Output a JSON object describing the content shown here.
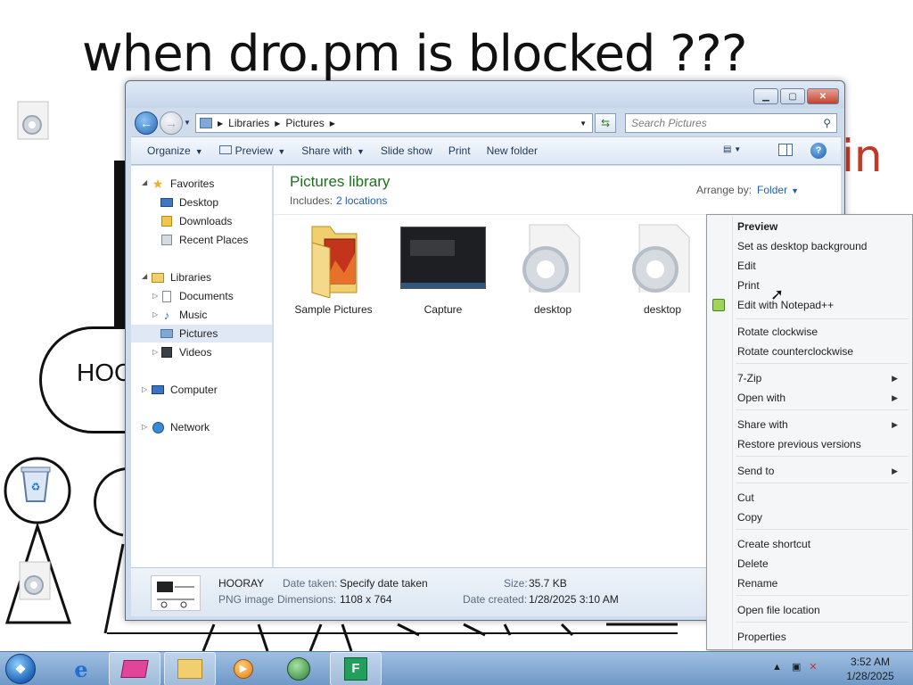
{
  "wallpaper": {
    "title": "when dro.pm is blocked ???",
    "side_text": "in",
    "bubble_text": "HOC"
  },
  "window": {
    "address": {
      "crumbs": [
        "Libraries",
        "Pictures"
      ]
    },
    "search_placeholder": "Search Pictures",
    "toolbar": {
      "organize": "Organize",
      "preview": "Preview",
      "share_with": "Share with",
      "slide_show": "Slide show",
      "print": "Print",
      "new_folder": "New folder"
    },
    "nav": {
      "favorites": "Favorites",
      "desktop": "Desktop",
      "downloads": "Downloads",
      "recent_places": "Recent Places",
      "libraries": "Libraries",
      "documents": "Documents",
      "music": "Music",
      "pictures": "Pictures",
      "videos": "Videos",
      "computer": "Computer",
      "network": "Network"
    },
    "library": {
      "title": "Pictures library",
      "includes_label": "Includes:",
      "locations_link": "2 locations",
      "arrange_label": "Arrange by:",
      "arrange_value": "Folder"
    },
    "files": [
      {
        "name": "Sample Pictures",
        "icon": "folder-icon"
      },
      {
        "name": "Capture",
        "icon": "image-thumbnail"
      },
      {
        "name": "desktop",
        "icon": "settings-file-icon"
      },
      {
        "name": "desktop",
        "icon": "settings-file-icon"
      }
    ],
    "details": {
      "name": "HOORAY",
      "type": "PNG image",
      "date_taken_label": "Date taken:",
      "date_taken_value": "Specify date taken",
      "dimensions_label": "Dimensions:",
      "dimensions_value": "1108 x 764",
      "size_label": "Size:",
      "size_value": "35.7 KB",
      "date_created_label": "Date created:",
      "date_created_value": "1/28/2025 3:10 AM"
    }
  },
  "context_menu": {
    "items": [
      {
        "label": "Preview"
      },
      {
        "label": "Set as desktop background"
      },
      {
        "label": "Edit"
      },
      {
        "label": "Print"
      },
      {
        "label": "Edit with Notepad++"
      },
      {
        "label": "Rotate clockwise"
      },
      {
        "label": "Rotate counterclockwise"
      },
      {
        "label": "7-Zip"
      },
      {
        "label": "Open with"
      },
      {
        "label": "Share with"
      },
      {
        "label": "Restore previous versions"
      },
      {
        "label": "Send to"
      },
      {
        "label": "Cut"
      },
      {
        "label": "Copy"
      },
      {
        "label": "Create shortcut"
      },
      {
        "label": "Delete"
      },
      {
        "label": "Rename"
      },
      {
        "label": "Open file location"
      },
      {
        "label": "Properties"
      }
    ]
  },
  "taskbar": {
    "time": "3:52 AM",
    "date": "1/28/2025"
  },
  "colors": {
    "library_title": "#1f6f1f",
    "link": "#1e5fb3",
    "taskbar": "#7ea6d2"
  }
}
